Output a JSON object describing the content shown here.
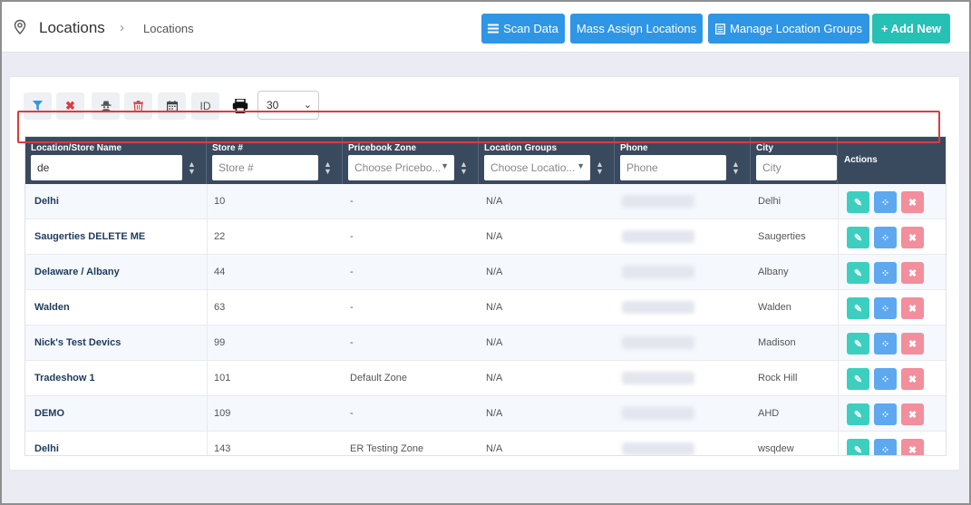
{
  "header": {
    "title": "Locations",
    "breadcrumb": "Locations",
    "buttons": {
      "scan": "Scan Data",
      "mass_assign": "Mass Assign Locations",
      "manage_groups": "Manage Location Groups",
      "add_new": "+ Add New"
    }
  },
  "toolbar": {
    "id_label": "ID",
    "per_page": "30"
  },
  "columns": {
    "name": "Location/Store Name",
    "store": "Store #",
    "zone": "Pricebook Zone",
    "groups": "Location Groups",
    "phone": "Phone",
    "city": "City",
    "actions": "Actions"
  },
  "filters": {
    "name_value": "de",
    "store_placeholder": "Store #",
    "zone_placeholder": "Choose Pricebo...",
    "groups_placeholder": "Choose Locatio...",
    "phone_placeholder": "Phone",
    "city_placeholder": "City"
  },
  "rows": [
    {
      "name": "Delhi",
      "store": "10",
      "zone": "-",
      "groups": "N/A",
      "city": "Delhi"
    },
    {
      "name": "Saugerties DELETE ME",
      "store": "22",
      "zone": "-",
      "groups": "N/A",
      "city": "Saugerties"
    },
    {
      "name": "Delaware / Albany",
      "store": "44",
      "zone": "-",
      "groups": "N/A",
      "city": "Albany"
    },
    {
      "name": "Walden",
      "store": "63",
      "zone": "-",
      "groups": "N/A",
      "city": "Walden"
    },
    {
      "name": "Nick's Test Devics",
      "store": "99",
      "zone": "-",
      "groups": "N/A",
      "city": "Madison"
    },
    {
      "name": "Tradeshow 1",
      "store": "101",
      "zone": "Default Zone",
      "groups": "N/A",
      "city": "Rock Hill"
    },
    {
      "name": "DEMO",
      "store": "109",
      "zone": "-",
      "groups": "N/A",
      "city": "AHD"
    },
    {
      "name": "Delhi",
      "store": "143",
      "zone": "ER Testing Zone",
      "groups": "N/A",
      "city": "wsqdew"
    }
  ]
}
